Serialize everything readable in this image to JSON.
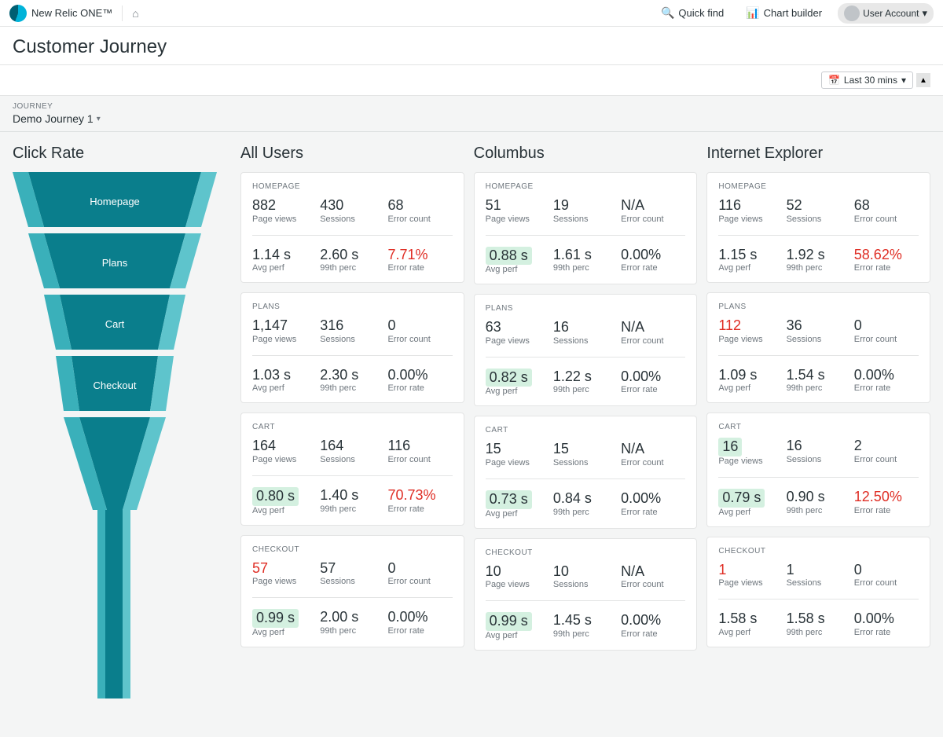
{
  "app": {
    "logo": "New Relic ONE™",
    "logo_tm": "™",
    "home_icon": "⌂",
    "quick_find_label": "Quick find",
    "chart_builder_label": "Chart builder",
    "user_name": "User Account",
    "last_time_label": "Last 30 mins"
  },
  "page": {
    "title": "Customer Journey"
  },
  "journey": {
    "label": "JOURNEY",
    "selected": "Demo Journey 1",
    "chevron": "▾"
  },
  "funnel": {
    "title": "Click Rate",
    "steps": [
      "Homepage",
      "Plans",
      "Cart",
      "Checkout"
    ]
  },
  "columns": [
    {
      "title": "All Users",
      "sections": [
        {
          "name": "HOMEPAGE",
          "page_views": "882",
          "page_views_label": "Page views",
          "sessions": "430",
          "sessions_label": "Sessions",
          "error_count": "68",
          "error_count_label": "Error count",
          "avg_perf": "1.14 s",
          "avg_perf_label": "Avg perf",
          "avg_perf_green": false,
          "perc_99": "2.60 s",
          "perc_99_label": "99th perc",
          "error_rate": "7.71%",
          "error_rate_label": "Error rate",
          "error_rate_red": true,
          "page_views_red": false
        },
        {
          "name": "PLANS",
          "page_views": "1,147",
          "page_views_label": "Page views",
          "sessions": "316",
          "sessions_label": "Sessions",
          "error_count": "0",
          "error_count_label": "Error count",
          "avg_perf": "1.03 s",
          "avg_perf_label": "Avg perf",
          "avg_perf_green": false,
          "perc_99": "2.30 s",
          "perc_99_label": "99th perc",
          "error_rate": "0.00%",
          "error_rate_label": "Error rate",
          "error_rate_red": false,
          "page_views_red": false
        },
        {
          "name": "CART",
          "page_views": "164",
          "page_views_label": "Page views",
          "sessions": "164",
          "sessions_label": "Sessions",
          "error_count": "116",
          "error_count_label": "Error count",
          "avg_perf": "0.80 s",
          "avg_perf_label": "Avg perf",
          "avg_perf_green": true,
          "perc_99": "1.40 s",
          "perc_99_label": "99th perc",
          "error_rate": "70.73%",
          "error_rate_label": "Error rate",
          "error_rate_red": true,
          "page_views_red": false
        },
        {
          "name": "CHECKOUT",
          "page_views": "57",
          "page_views_label": "Page views",
          "sessions": "57",
          "sessions_label": "Sessions",
          "error_count": "0",
          "error_count_label": "Error count",
          "avg_perf": "0.99 s",
          "avg_perf_label": "Avg perf",
          "avg_perf_green": true,
          "perc_99": "2.00 s",
          "perc_99_label": "99th perc",
          "error_rate": "0.00%",
          "error_rate_label": "Error rate",
          "error_rate_red": false,
          "page_views_red": true
        }
      ]
    },
    {
      "title": "Columbus",
      "sections": [
        {
          "name": "HOMEPAGE",
          "page_views": "51",
          "page_views_label": "Page views",
          "sessions": "19",
          "sessions_label": "Sessions",
          "error_count": "N/A",
          "error_count_label": "Error count",
          "avg_perf": "0.88 s",
          "avg_perf_label": "Avg perf",
          "avg_perf_green": true,
          "perc_99": "1.61 s",
          "perc_99_label": "99th perc",
          "error_rate": "0.00%",
          "error_rate_label": "Error rate",
          "error_rate_red": false,
          "page_views_red": false
        },
        {
          "name": "PLANS",
          "page_views": "63",
          "page_views_label": "Page views",
          "sessions": "16",
          "sessions_label": "Sessions",
          "error_count": "N/A",
          "error_count_label": "Error count",
          "avg_perf": "0.82 s",
          "avg_perf_label": "Avg perf",
          "avg_perf_green": true,
          "perc_99": "1.22 s",
          "perc_99_label": "99th perc",
          "error_rate": "0.00%",
          "error_rate_label": "Error rate",
          "error_rate_red": false,
          "page_views_red": false
        },
        {
          "name": "CART",
          "page_views": "15",
          "page_views_label": "Page views",
          "sessions": "15",
          "sessions_label": "Sessions",
          "error_count": "N/A",
          "error_count_label": "Error count",
          "avg_perf": "0.73 s",
          "avg_perf_label": "Avg perf",
          "avg_perf_green": true,
          "perc_99": "0.84 s",
          "perc_99_label": "99th perc",
          "error_rate": "0.00%",
          "error_rate_label": "Error rate",
          "error_rate_red": false,
          "page_views_red": false
        },
        {
          "name": "CHECKOUT",
          "page_views": "10",
          "page_views_label": "Page views",
          "sessions": "10",
          "sessions_label": "Sessions",
          "error_count": "N/A",
          "error_count_label": "Error count",
          "avg_perf": "0.99 s",
          "avg_perf_label": "Avg perf",
          "avg_perf_green": true,
          "perc_99": "1.45 s",
          "perc_99_label": "99th perc",
          "error_rate": "0.00%",
          "error_rate_label": "Error rate",
          "error_rate_red": false,
          "page_views_red": false
        }
      ]
    },
    {
      "title": "Internet Explorer",
      "sections": [
        {
          "name": "HOMEPAGE",
          "page_views": "116",
          "page_views_label": "Page views",
          "sessions": "52",
          "sessions_label": "Sessions",
          "error_count": "68",
          "error_count_label": "Error count",
          "avg_perf": "1.15 s",
          "avg_perf_label": "Avg perf",
          "avg_perf_green": false,
          "perc_99": "1.92 s",
          "perc_99_label": "99th perc",
          "error_rate": "58.62%",
          "error_rate_label": "Error rate",
          "error_rate_red": true,
          "page_views_red": false
        },
        {
          "name": "PLANS",
          "page_views": "112",
          "page_views_label": "Page views",
          "sessions": "36",
          "sessions_label": "Sessions",
          "error_count": "0",
          "error_count_label": "Error count",
          "avg_perf": "1.09 s",
          "avg_perf_label": "Avg perf",
          "avg_perf_green": false,
          "perc_99": "1.54 s",
          "perc_99_label": "99th perc",
          "error_rate": "0.00%",
          "error_rate_label": "Error rate",
          "error_rate_red": false,
          "page_views_red": true
        },
        {
          "name": "CART",
          "page_views": "16",
          "page_views_label": "Page views",
          "sessions": "16",
          "sessions_label": "Sessions",
          "error_count": "2",
          "error_count_label": "Error count",
          "avg_perf": "0.79 s",
          "avg_perf_label": "Avg perf",
          "avg_perf_green": true,
          "perc_99": "0.90 s",
          "perc_99_label": "99th perc",
          "error_rate": "12.50%",
          "error_rate_label": "Error rate",
          "error_rate_red": true,
          "page_views_green": true
        },
        {
          "name": "CHECKOUT",
          "page_views": "1",
          "page_views_label": "Page views",
          "sessions": "1",
          "sessions_label": "Sessions",
          "error_count": "0",
          "error_count_label": "Error count",
          "avg_perf": "1.58 s",
          "avg_perf_label": "Avg perf",
          "avg_perf_green": false,
          "perc_99": "1.58 s",
          "perc_99_label": "99th perc",
          "error_rate": "0.00%",
          "error_rate_label": "Error rate",
          "error_rate_red": false,
          "page_views_red": true
        }
      ]
    }
  ]
}
